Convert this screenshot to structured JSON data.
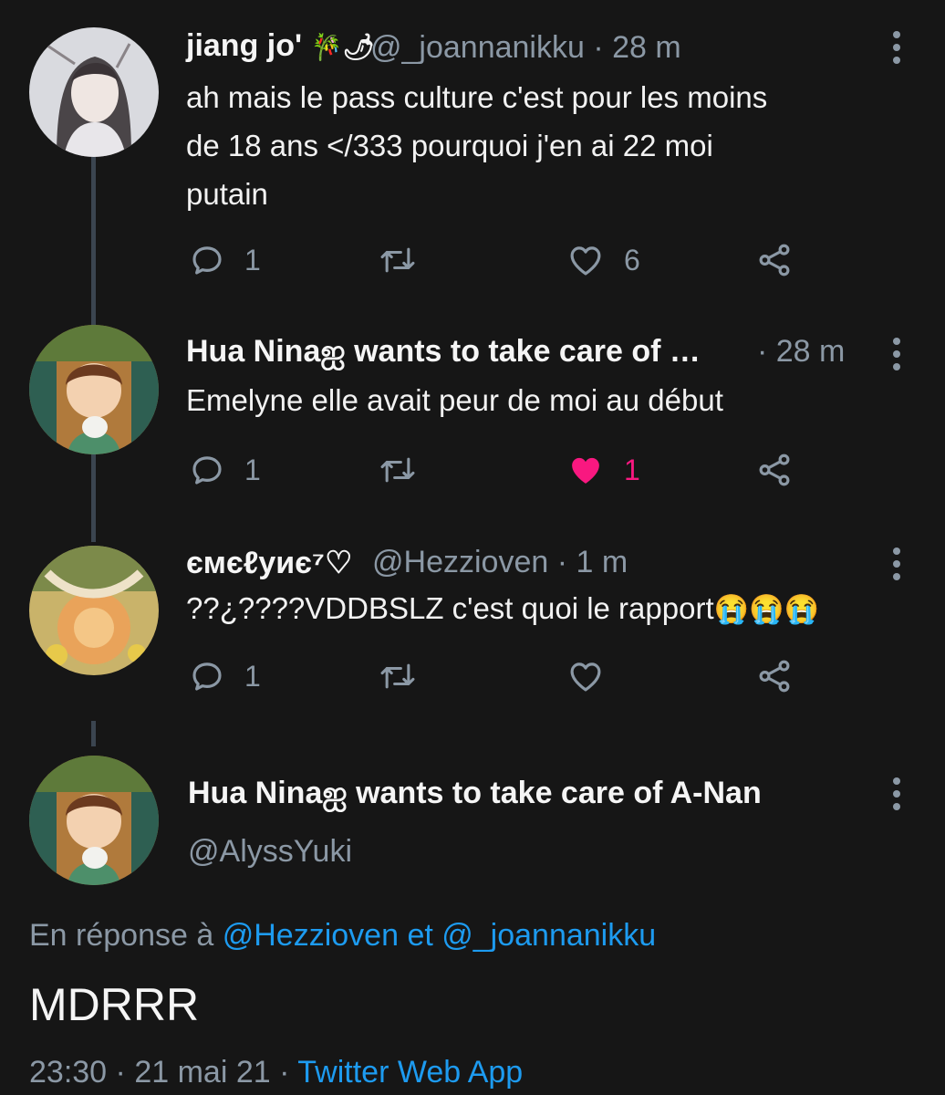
{
  "tweets": [
    {
      "name": "jiang jo'",
      "name_emoji": "🎋🌶",
      "handle": "@_joannanikku",
      "time": "· 28 m",
      "text_lines": [
        "ah mais le pass culture c'est pour les moins",
        "de 18 ans </333 pourquoi j'en ai 22 moi",
        "putain"
      ],
      "reply_count": "1",
      "retweet_count": "",
      "like_count": "6",
      "liked": false
    },
    {
      "name": "Hua Ninaஐ wants to take care of …",
      "time": "· 28 m",
      "text_lines": [
        "Emelyne elle avait peur de moi au début"
      ],
      "reply_count": "1",
      "retweet_count": "",
      "like_count": "1",
      "liked": true
    },
    {
      "name": "ємєℓуиє⁷♡",
      "handle": "@Hezzioven",
      "time": "· 1 m",
      "text": "??¿????VDDBSLZ c'est quoi le rapport",
      "emoji": "😭😭😭",
      "reply_count": "1",
      "retweet_count": "",
      "like_count": "",
      "liked": false
    }
  ],
  "main_tweet": {
    "name": "Hua Ninaஐ wants to take care of A-Nan",
    "handle": "@AlyssYuki",
    "reply_prefix": "En réponse à",
    "reply_user_1": "@Hezzioven",
    "reply_joiner": "et",
    "reply_user_2": "@_joannanikku",
    "text": "MDRRR",
    "time": "23:30",
    "sep1": "·",
    "date": "21 mai 21",
    "sep2": "·",
    "source": "Twitter Web App"
  },
  "colors": {
    "background": "#161616",
    "muted": "#8b98a5",
    "link": "#1d9bf0",
    "like": "#f91880",
    "thread_line": "#3b4550"
  }
}
